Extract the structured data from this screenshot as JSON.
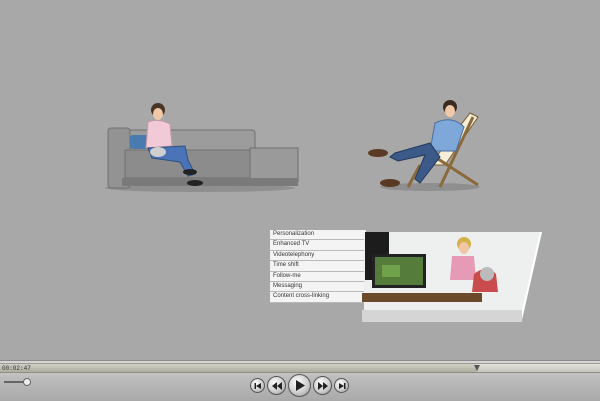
{
  "menu": {
    "items": [
      {
        "label": "Personalization"
      },
      {
        "label": "Enhanced TV"
      },
      {
        "label": "Videotelephony"
      },
      {
        "label": "Time shift"
      },
      {
        "label": "Follow-me"
      },
      {
        "label": "Messaging"
      },
      {
        "label": "Content cross-linking"
      }
    ]
  },
  "player": {
    "time": "00:02:47",
    "progress": 0.795,
    "volume": 0.85,
    "buttons": {
      "skip_back": "skip-back-icon",
      "rewind": "rewind-icon",
      "play": "play-icon",
      "fast_forward": "fast-forward-icon",
      "skip_forward": "skip-forward-icon"
    }
  },
  "colors": {
    "background": "#a8a8a8",
    "sofa": "#9a9a9a",
    "menu_bg": "#f4f4f4"
  }
}
